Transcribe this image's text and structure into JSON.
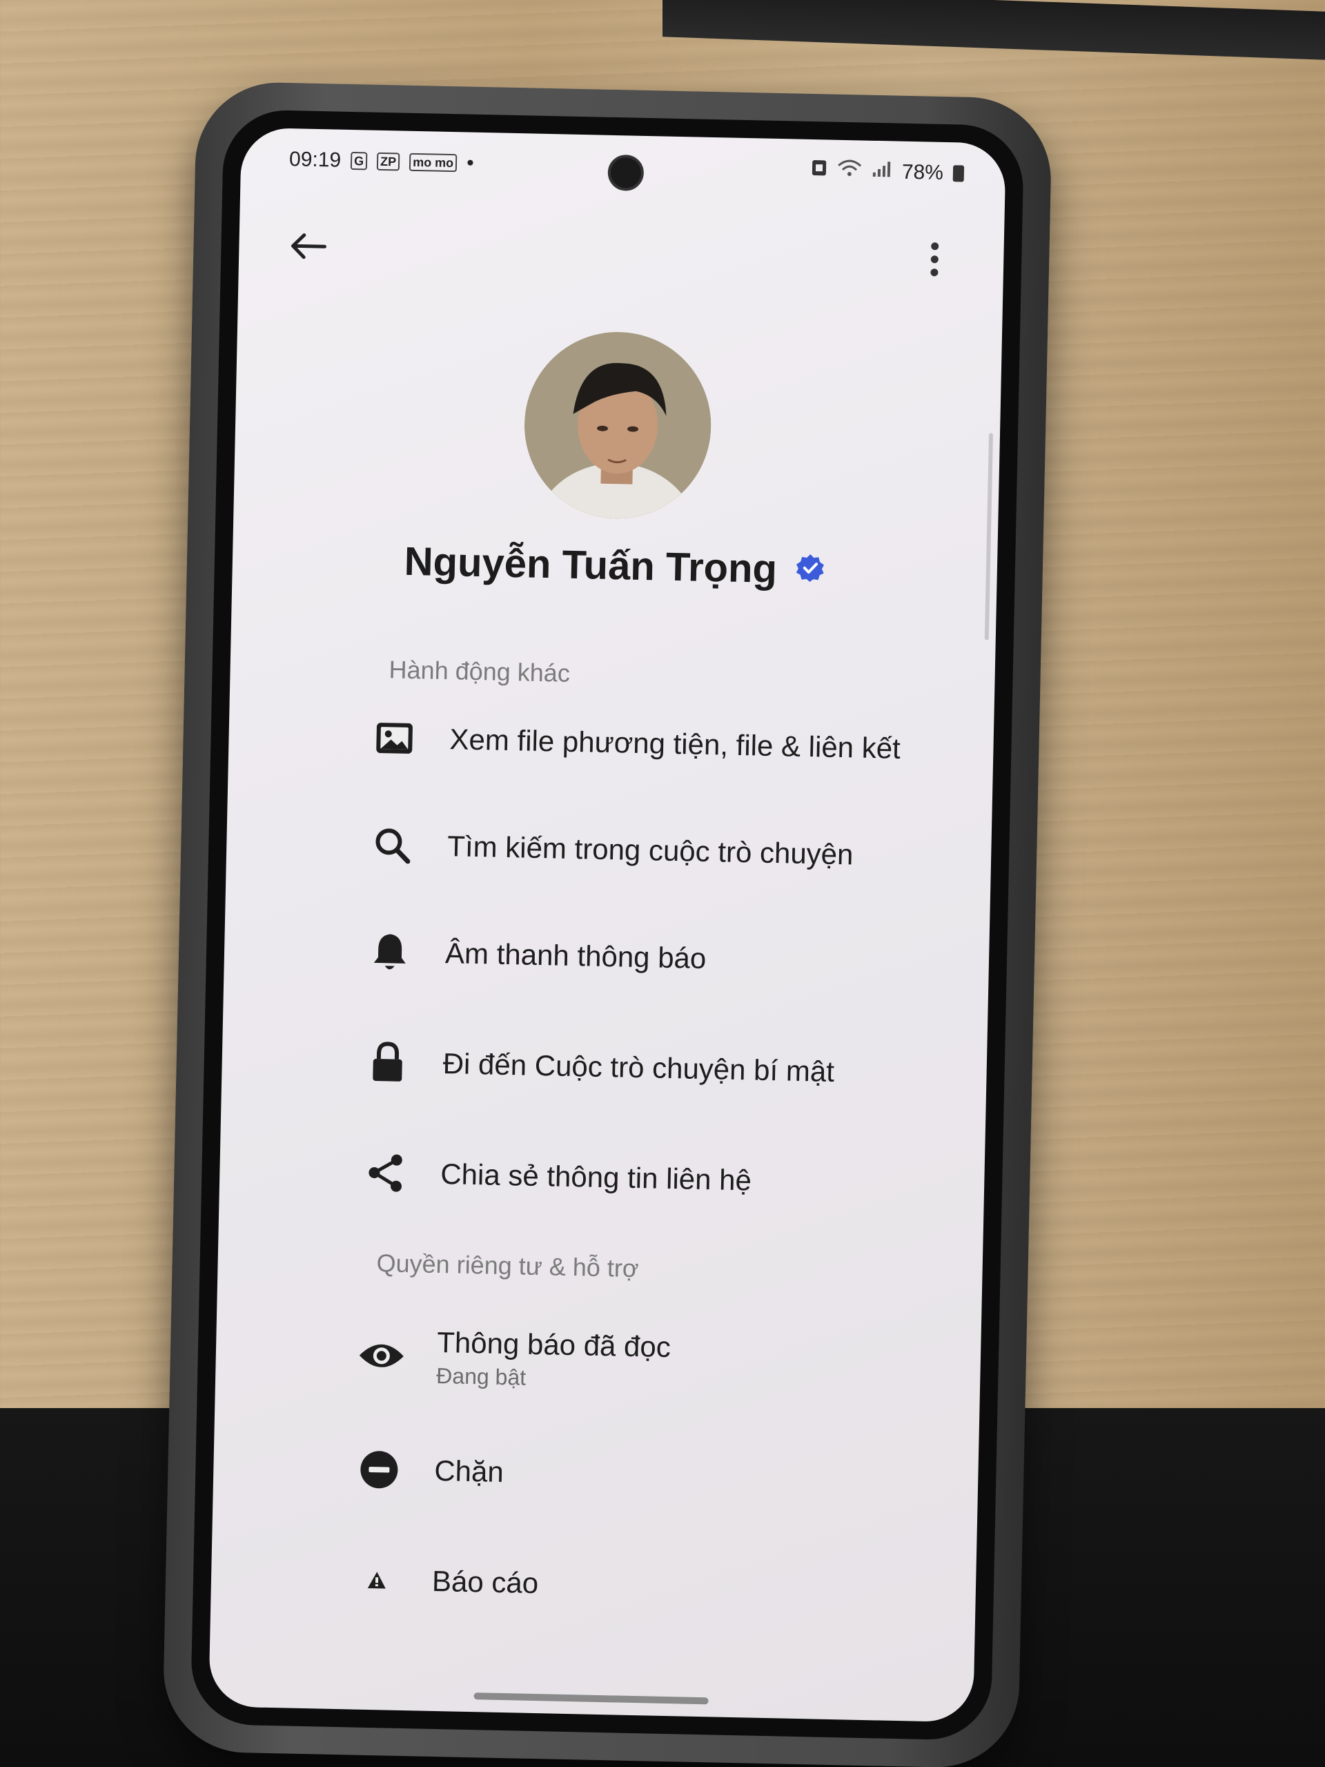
{
  "status_bar": {
    "time": "09:19",
    "badge_g": "G",
    "badge_zp": "ZP",
    "badge_momo": "mo mo",
    "battery": "78%"
  },
  "header": {
    "back_icon": "arrow-left-icon",
    "more_icon": "more-vertical-icon"
  },
  "profile": {
    "name": "Nguyễn Tuấn Trọng",
    "verified": true,
    "verified_color": "#3b5bdb"
  },
  "sections": {
    "other_actions": {
      "title": "Hành động khác",
      "items": [
        {
          "icon": "image-icon",
          "label": "Xem file phương tiện, file & liên kết"
        },
        {
          "icon": "search-icon",
          "label": "Tìm kiếm trong cuộc trò chuyện"
        },
        {
          "icon": "bell-icon",
          "label": "Âm thanh thông báo"
        },
        {
          "icon": "lock-icon",
          "label": "Đi đến Cuộc trò chuyện bí mật"
        },
        {
          "icon": "share-icon",
          "label": "Chia sẻ thông tin liên hệ"
        }
      ]
    },
    "privacy_support": {
      "title": "Quyền riêng tư & hỗ trợ",
      "items": [
        {
          "icon": "eye-icon",
          "label": "Thông báo đã đọc",
          "sub": "Đang bật"
        },
        {
          "icon": "block-icon",
          "label": "Chặn"
        },
        {
          "icon": "warning-icon",
          "label": "Báo cáo"
        }
      ]
    }
  }
}
